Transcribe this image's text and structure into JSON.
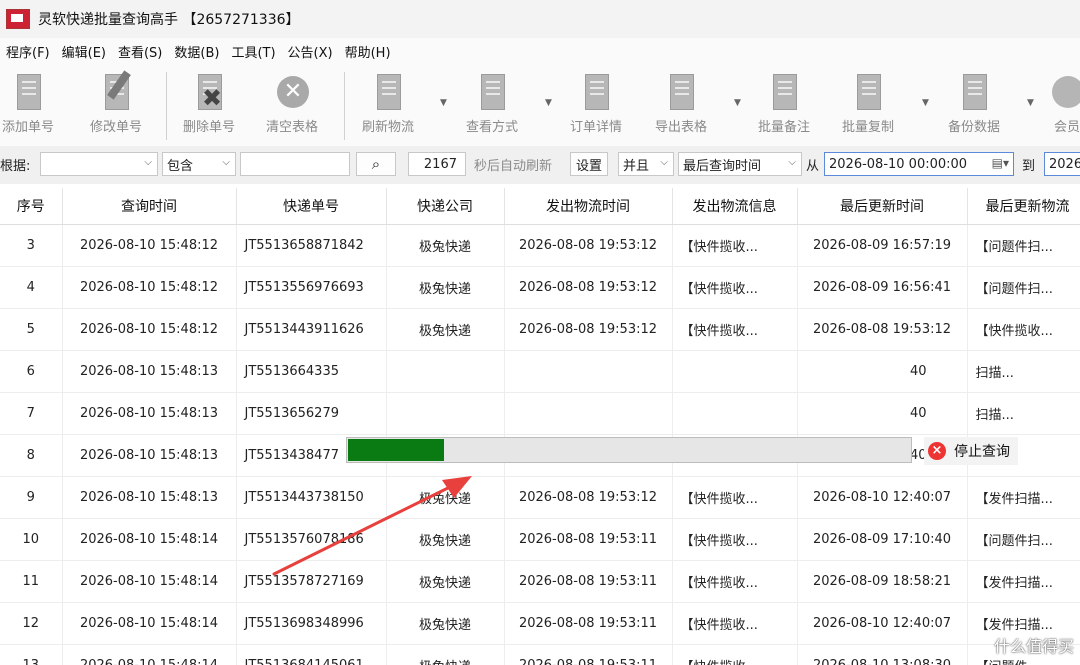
{
  "window": {
    "title": "灵软快递批量查询高手 【2657271336】"
  },
  "menu": [
    "程序(F)",
    "编辑(E)",
    "查看(S)",
    "数据(B)",
    "工具(T)",
    "公告(X)",
    "帮助(H)"
  ],
  "toolbar": {
    "add": "添加单号",
    "edit": "修改单号",
    "delete": "删除单号",
    "clear": "清空表格",
    "refresh": "刷新物流",
    "view_mode": "查看方式",
    "order_detail": "订单详情",
    "export": "导出表格",
    "batch_note": "批量备注",
    "batch_copy": "批量复制",
    "backup": "备份数据",
    "member": "会员"
  },
  "filter": {
    "by_label": "根据:",
    "by_value": "",
    "match_value": "包含",
    "keyword": "",
    "interval": "2167",
    "auto_refresh_label": "秒后自动刷新",
    "settings_button": "设置",
    "logic_value": "并且",
    "time_field_value": "最后查询时间",
    "from_label": "从",
    "from_date": "2026-08-10 00:00:00",
    "to_label": "到",
    "to_date": "2026"
  },
  "table": {
    "columns": [
      "序号",
      "查询时间",
      "快递单号",
      "快递公司",
      "发出物流时间",
      "发出物流信息",
      "最后更新时间",
      "最后更新物流"
    ],
    "rows": [
      [
        "3",
        "2026-08-10 15:48:12",
        "JT5513658871842",
        "极兔快递",
        "2026-08-08 19:53:12",
        "【快件揽收...",
        "2026-08-09 16:57:19",
        "【问题件扫..."
      ],
      [
        "4",
        "2026-08-10 15:48:12",
        "JT5513556976693",
        "极兔快递",
        "2026-08-08 19:53:12",
        "【快件揽收...",
        "2026-08-09 16:56:41",
        "【问题件扫..."
      ],
      [
        "5",
        "2026-08-10 15:48:12",
        "JT5513443911626",
        "极兔快递",
        "2026-08-08 19:53:12",
        "【快件揽收...",
        "2026-08-08 19:53:12",
        "【快件揽收..."
      ],
      [
        "6",
        "2026-08-10 15:48:13",
        "JT5513664335",
        "",
        "",
        "",
        "40",
        "扫描..."
      ],
      [
        "7",
        "2026-08-10 15:48:13",
        "JT5513656279",
        "",
        "",
        "",
        "40",
        "扫描..."
      ],
      [
        "8",
        "2026-08-10 15:48:13",
        "JT5513438477",
        "",
        "",
        "",
        "40",
        "扫描..."
      ],
      [
        "9",
        "2026-08-10 15:48:13",
        "JT5513443738150",
        "极兔快递",
        "2026-08-08 19:53:12",
        "【快件揽收...",
        "2026-08-10 12:40:07",
        "【发件扫描..."
      ],
      [
        "10",
        "2026-08-10 15:48:14",
        "JT5513576078186",
        "极兔快递",
        "2026-08-08 19:53:11",
        "【快件揽收...",
        "2026-08-09 17:10:40",
        "【问题件扫..."
      ],
      [
        "11",
        "2026-08-10 15:48:14",
        "JT5513578727169",
        "极兔快递",
        "2026-08-08 19:53:11",
        "【快件揽收...",
        "2026-08-09 18:58:21",
        "【发件扫描..."
      ],
      [
        "12",
        "2026-08-10 15:48:14",
        "JT5513698348996",
        "极兔快递",
        "2026-08-08 19:53:11",
        "【快件揽收...",
        "2026-08-10 12:40:07",
        "【发件扫描..."
      ],
      [
        "13",
        "2026-08-10 15:48:14",
        "JT5513684145061",
        "极兔快递",
        "2026-08-08 19:53:11",
        "【快件揽收...",
        "2026-08-10 13:08:30",
        "【问题件..."
      ]
    ]
  },
  "progress": {
    "fraction": 0.17,
    "stop_label": "停止查询",
    "fill_color": "#0a7a12"
  },
  "watermark": "什么值得买",
  "icons": {
    "stop": "stop-circle-x-icon",
    "search": "magnifier-icon",
    "calendar": "calendar-icon"
  },
  "colors": {
    "annotation_arrow": "#e8403c"
  }
}
